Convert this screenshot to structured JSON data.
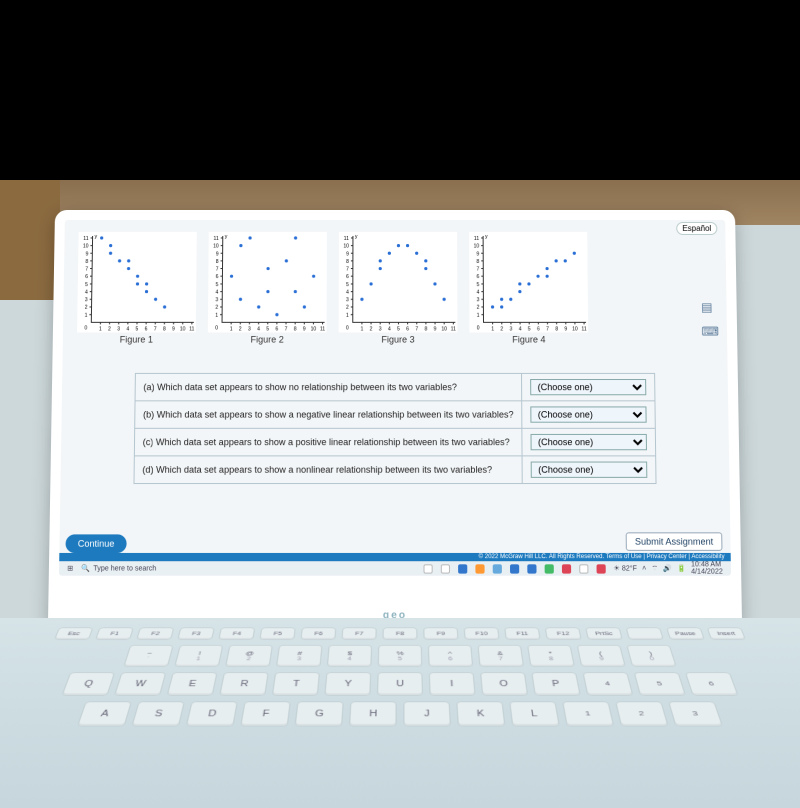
{
  "espanol_btn": "Español",
  "figures": [
    {
      "label": "Figure 1"
    },
    {
      "label": "Figure 2"
    },
    {
      "label": "Figure 3"
    },
    {
      "label": "Figure 4"
    }
  ],
  "chart_data": [
    {
      "type": "scatter",
      "title": "Figure 1",
      "xlabel": "",
      "ylabel": "",
      "xlim": [
        0,
        11
      ],
      "ylim": [
        0,
        11
      ],
      "x": [
        1,
        2,
        2,
        3,
        4,
        4,
        5,
        5,
        6,
        6,
        7,
        8
      ],
      "y": [
        11,
        10,
        9,
        8,
        7,
        8,
        6,
        5,
        5,
        4,
        3,
        2
      ]
    },
    {
      "type": "scatter",
      "title": "Figure 2",
      "xlabel": "",
      "ylabel": "",
      "xlim": [
        0,
        11
      ],
      "ylim": [
        0,
        11
      ],
      "x": [
        1,
        2,
        2,
        3,
        4,
        5,
        5,
        6,
        7,
        8,
        8,
        9,
        10
      ],
      "y": [
        6,
        10,
        3,
        11,
        2,
        7,
        4,
        1,
        8,
        4,
        11,
        2,
        6
      ]
    },
    {
      "type": "scatter",
      "title": "Figure 3",
      "xlabel": "",
      "ylabel": "",
      "xlim": [
        0,
        11
      ],
      "ylim": [
        0,
        11
      ],
      "x": [
        1,
        2,
        3,
        3,
        4,
        5,
        6,
        7,
        8,
        8,
        9,
        10
      ],
      "y": [
        3,
        5,
        7,
        8,
        9,
        10,
        10,
        9,
        8,
        7,
        5,
        3
      ]
    },
    {
      "type": "scatter",
      "title": "Figure 4",
      "xlabel": "",
      "ylabel": "",
      "xlim": [
        0,
        11
      ],
      "ylim": [
        0,
        11
      ],
      "x": [
        1,
        2,
        2,
        3,
        4,
        4,
        5,
        6,
        7,
        7,
        8,
        9,
        10
      ],
      "y": [
        2,
        2,
        3,
        3,
        4,
        5,
        5,
        6,
        6,
        7,
        8,
        8,
        9
      ]
    }
  ],
  "questions": {
    "a": {
      "label": "(a)",
      "text": "Which data set appears to show no relationship between its two variables?",
      "placeholder": "(Choose one)"
    },
    "b": {
      "label": "(b)",
      "text": "Which data set appears to show a negative linear relationship between its two variables?",
      "placeholder": "(Choose one)"
    },
    "c": {
      "label": "(c)",
      "text": "Which data set appears to show a positive linear relationship between its two variables?",
      "placeholder": "(Choose one)"
    },
    "d": {
      "label": "(d)",
      "text": "Which data set appears to show a nonlinear relationship between its two variables?",
      "placeholder": "(Choose one)"
    }
  },
  "buttons": {
    "continue": "Continue",
    "submit": "Submit Assignment"
  },
  "footer": "© 2022 McGraw Hill LLC. All Rights Reserved.   Terms of Use  |  Privacy Center  |  Accessibility",
  "taskbar": {
    "search_placeholder": "Type here to search",
    "weather": "82°F",
    "time": "10:48 AM",
    "date": "4/14/2022"
  },
  "brand": "geo",
  "keyboard": {
    "fn": [
      "Esc",
      "F1",
      "F2",
      "F3",
      "F4",
      "F5",
      "F6",
      "F7",
      "F8",
      "F9",
      "F10",
      "F11",
      "F12",
      "PrtSc",
      "",
      "Pause",
      "Insert"
    ],
    "r1": [
      [
        "~",
        "`"
      ],
      [
        "!",
        "1"
      ],
      [
        "@",
        "2"
      ],
      [
        "#",
        "3"
      ],
      [
        "$",
        "4"
      ],
      [
        "%",
        "5"
      ],
      [
        "^",
        "6"
      ],
      [
        "&",
        "7"
      ],
      [
        "*",
        "8"
      ],
      [
        "(",
        "9"
      ],
      [
        ")",
        "0"
      ]
    ],
    "r2": [
      "Q",
      "W",
      "E",
      "R",
      "T",
      "Y",
      "U",
      "I",
      "O",
      "P"
    ],
    "r2_side": [
      [
        "4",
        ""
      ],
      [
        "5",
        ""
      ],
      [
        "6",
        ""
      ]
    ],
    "r3": [
      "A",
      "S",
      "D",
      "F",
      "G",
      "H",
      "J",
      "K",
      "L"
    ],
    "r3_side": [
      [
        "1",
        ""
      ],
      [
        "2",
        ""
      ],
      [
        "3",
        ""
      ]
    ]
  }
}
